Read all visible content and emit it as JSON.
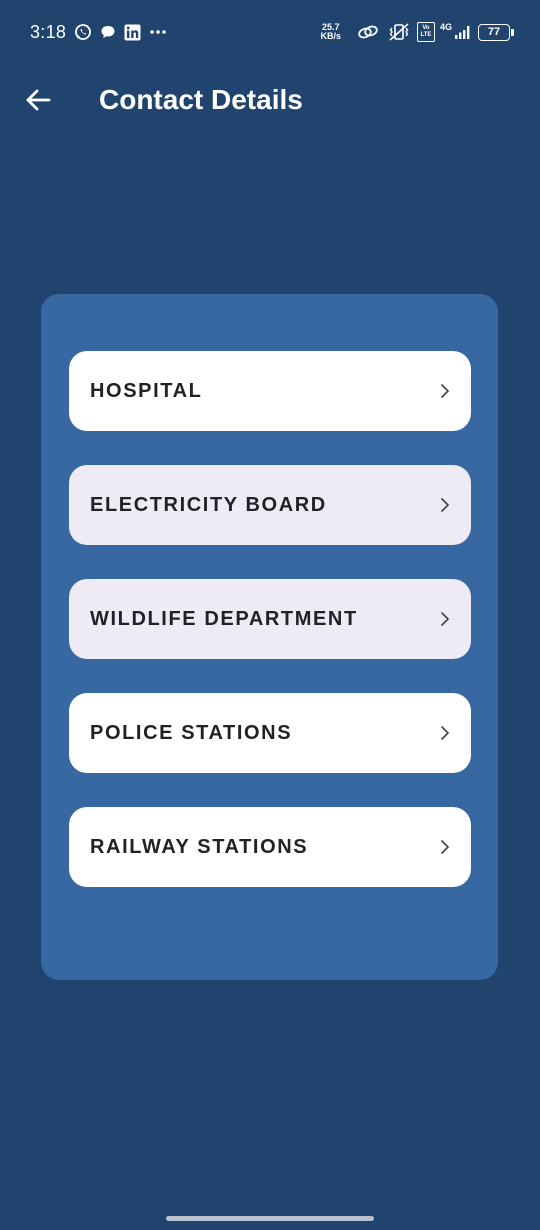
{
  "status_bar": {
    "time": "3:18",
    "net_speed_value": "25.7",
    "net_speed_unit": "KB/s",
    "volte_top": "Vo",
    "volte_bottom": "LTE",
    "network_type": "4G",
    "battery_level": "77",
    "icons": [
      "whatsapp-icon",
      "chat-icon",
      "linkedin-icon",
      "more-notifications-icon",
      "link-icon",
      "vibrate-icon",
      "signal-icon"
    ]
  },
  "app_bar": {
    "title": "Contact Details",
    "back_icon": "arrow-left-icon"
  },
  "contacts": {
    "items": [
      {
        "label": "HOSPITAL",
        "style": "white"
      },
      {
        "label": "ELECTRICITY BOARD",
        "style": "lavender"
      },
      {
        "label": "WILDLIFE DEPARTMENT",
        "style": "lavender"
      },
      {
        "label": "POLICE STATIONS",
        "style": "white"
      },
      {
        "label": "RAILWAY STATIONS",
        "style": "white"
      }
    ]
  },
  "colors": {
    "background": "#21446f",
    "card": "#3868a2",
    "item_white": "#ffffff",
    "item_lavender": "#eeebf5",
    "item_text": "#222226"
  }
}
